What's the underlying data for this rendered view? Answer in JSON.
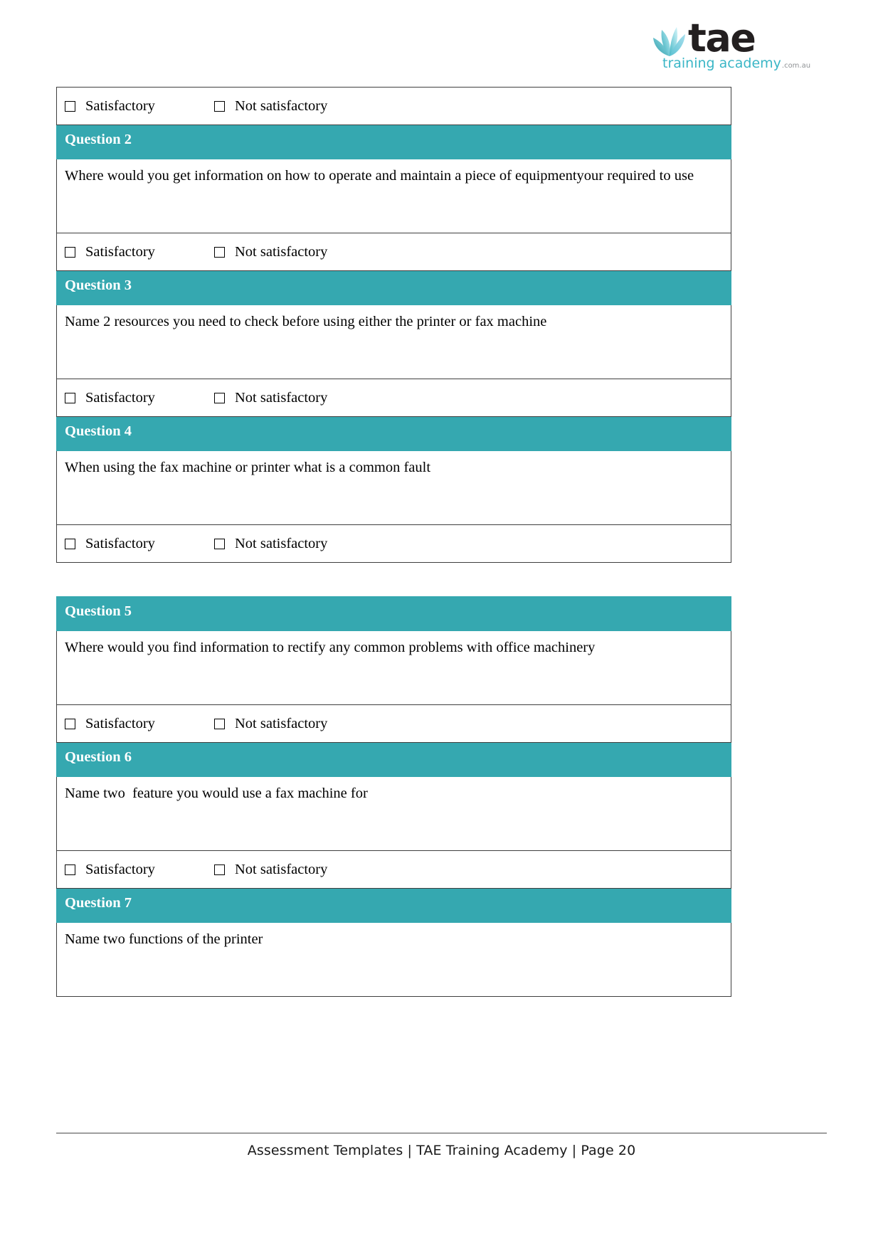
{
  "brand": {
    "logo_word": "tae",
    "logo_sub": "training academy",
    "logo_tld": ".com.au",
    "logo_mark_name": "tae-leaf-mark",
    "teal": "#35a8b0",
    "logo_teal": "#3ab6c6"
  },
  "labels": {
    "satisfactory": "Satisfactory",
    "not_satisfactory": "Not satisfactory"
  },
  "table1": {
    "top_result": {
      "satisfactory": "Satisfactory",
      "not_satisfactory": "Not satisfactory"
    },
    "questions": [
      {
        "header": "Question 2",
        "text": "Where would you get information on how to operate and maintain a piece of equipmentyour required to use",
        "satisfactory": "Satisfactory",
        "not_satisfactory": "Not satisfactory"
      },
      {
        "header": "Question 3",
        "text": "Name 2 resources you need to check before using either the printer or fax machine",
        "satisfactory": "Satisfactory",
        "not_satisfactory": "Not satisfactory"
      },
      {
        "header": "Question 4",
        "text": "When using the fax machine or printer what is a common fault",
        "satisfactory": "Satisfactory",
        "not_satisfactory": "Not satisfactory"
      }
    ]
  },
  "table2": {
    "questions": [
      {
        "header": "Question 5",
        "text": "Where would you find information to rectify any common problems with office machinery",
        "satisfactory": "Satisfactory",
        "not_satisfactory": "Not satisfactory"
      },
      {
        "header": "Question 6",
        "text": "Name two  feature you would use a fax machine for",
        "satisfactory": "Satisfactory",
        "not_satisfactory": "Not satisfactory"
      },
      {
        "header": "Question 7",
        "text": "Name two functions of the printer",
        "satisfactory": null,
        "not_satisfactory": null
      }
    ]
  },
  "footer": {
    "text": "Assessment Templates | TAE Training Academy | Page 20"
  }
}
